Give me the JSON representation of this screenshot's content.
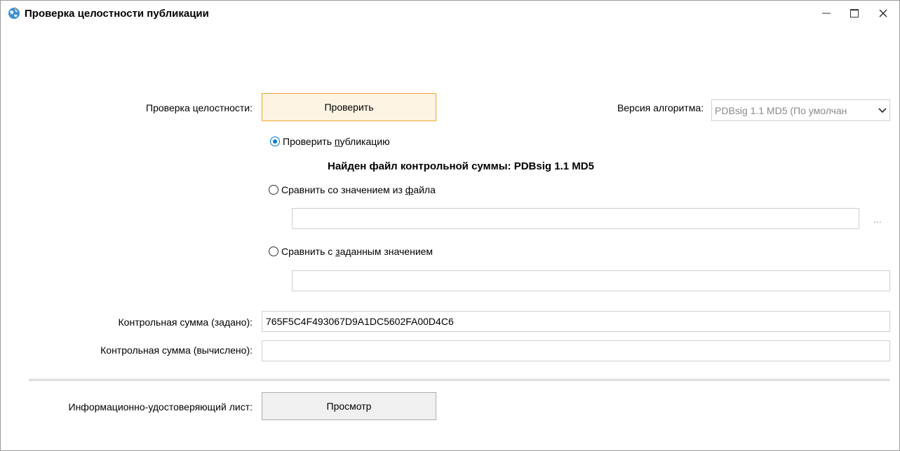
{
  "window": {
    "title": "Проверка целостности публикации",
    "controls": {
      "minimize": "minimize-icon",
      "maximize": "maximize-icon",
      "close": "close-icon"
    }
  },
  "integrity": {
    "label": "Проверка целостности:",
    "check_button": "Проверить"
  },
  "algorithm": {
    "label": "Версия алгоритма:",
    "selected": "PDBsig 1.1 MD5 (По умолчан"
  },
  "options": {
    "verify_publication": {
      "pre": "Проверить ",
      "underline": "п",
      "post": "убликацию",
      "checked": true
    },
    "found_file_text": "Найден файл контрольной суммы: PDBsig 1.1 MD5",
    "compare_file": {
      "pre": "Сравнить со значением из ",
      "underline": "ф",
      "post": "айла",
      "checked": false
    },
    "file_path_value": "",
    "browse_label": "...",
    "compare_value": {
      "pre": "Сравнить с ",
      "underline": "з",
      "post": "аданным значением",
      "checked": false
    },
    "custom_value": ""
  },
  "checksum": {
    "given_label": "Контрольная сумма (задано):",
    "given_value": "765F5C4F493067D9A1DC5602FA00D4C6",
    "computed_label": "Контрольная сумма (вычислено):",
    "computed_value": ""
  },
  "info_sheet": {
    "label": "Информационно-удостоверяющий лист:",
    "view_button": "Просмотр"
  },
  "colors": {
    "accent": "#0078d7",
    "active_button_border": "#f2a62c",
    "active_button_bg": "#fdf4e3"
  }
}
